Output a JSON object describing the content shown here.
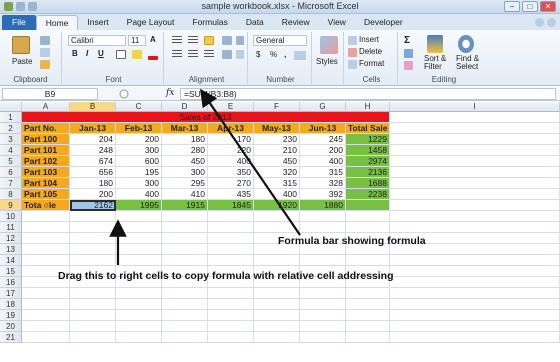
{
  "window": {
    "title": "sample workbook.xlsx - Microsoft Excel",
    "controls": [
      "–",
      "□",
      "✕"
    ]
  },
  "tabs": [
    "File",
    "Home",
    "Insert",
    "Page Layout",
    "Formulas",
    "Data",
    "Review",
    "View",
    "Developer"
  ],
  "ribbon": {
    "clipboard": {
      "paste": "Paste",
      "label": "Clipboard"
    },
    "font": {
      "name": "Calibri",
      "size": "11",
      "bold": "B",
      "italic": "I",
      "underline": "U",
      "grow": "A",
      "shrink": "A",
      "label": "Font"
    },
    "alignment": {
      "label": "Alignment"
    },
    "number": {
      "format": "General",
      "currency": "$",
      "percent": "%",
      "comma": ",",
      "label": "Number"
    },
    "styles": {
      "label": "Styles"
    },
    "cells": {
      "insert": "Insert",
      "delete": "Delete",
      "format": "Format",
      "label": "Cells"
    },
    "editing": {
      "sigma": "Σ",
      "sort": "Sort &",
      "filter": "Filter",
      "find": "Find &",
      "select": "Select",
      "label": "Editing"
    }
  },
  "formula_bar": {
    "name_box": "B9",
    "fx": "fx",
    "formula": "=SUM(B3:B8)"
  },
  "columns": [
    "A",
    "B",
    "C",
    "D",
    "E",
    "F",
    "G",
    "H",
    "I"
  ],
  "rows": [
    "1",
    "2",
    "3",
    "4",
    "5",
    "6",
    "7",
    "8",
    "9",
    "10",
    "11",
    "12",
    "13",
    "14",
    "15",
    "16",
    "17",
    "18",
    "19",
    "20",
    "21"
  ],
  "sheet": {
    "title": "Sales of 2013",
    "headers": [
      "Part No.",
      "Jan-13",
      "Feb-13",
      "Mar-13",
      "Apr-13",
      "May-13",
      "Jun-13",
      "Total Sale"
    ],
    "data": [
      [
        "Part 100",
        "204",
        "200",
        "180",
        "170",
        "230",
        "245",
        "1229"
      ],
      [
        "Part 101",
        "248",
        "300",
        "280",
        "220",
        "210",
        "200",
        "1458"
      ],
      [
        "Part 102",
        "674",
        "600",
        "450",
        "400",
        "450",
        "400",
        "2974"
      ],
      [
        "Part 103",
        "656",
        "195",
        "300",
        "350",
        "320",
        "315",
        "2136"
      ],
      [
        "Part 104",
        "180",
        "300",
        "295",
        "270",
        "315",
        "328",
        "1688"
      ],
      [
        "Part 105",
        "200",
        "400",
        "410",
        "435",
        "400",
        "392",
        "2238"
      ]
    ],
    "totals": [
      "Tota",
      "le",
      "2162",
      "1995",
      "1915",
      "1845",
      "1920",
      "1880"
    ]
  },
  "annotations": {
    "formula_bar": "Formula bar showing formula",
    "drag": "Drag this to right cells to copy formula with relative cell addressing"
  },
  "colors": {
    "title_bg": "#e8141b",
    "header_bg": "#f6a81f",
    "total_bg": "#77c043",
    "selected": "#9fc7e8"
  }
}
